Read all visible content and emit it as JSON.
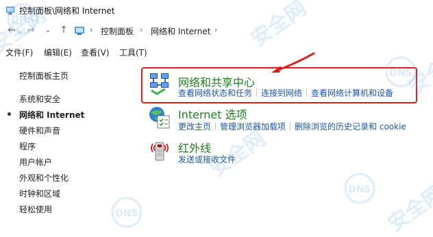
{
  "window": {
    "title": "控制面板\\网络和 Internet"
  },
  "nav": {
    "back_label": "←",
    "forward_label": "→",
    "dropdown_label": "⌄",
    "up_label": "↑",
    "breadcrumb": [
      {
        "label": "控制面板"
      },
      {
        "label": "网络和 Internet"
      }
    ],
    "separator": "›"
  },
  "menu": {
    "items": [
      {
        "label": "文件(F)"
      },
      {
        "label": "编辑(E)"
      },
      {
        "label": "查看(V)"
      },
      {
        "label": "工具(T)"
      }
    ]
  },
  "sidebar": {
    "items": [
      {
        "label": "控制面板主页",
        "current": false
      },
      {
        "label": "系统和安全",
        "current": false
      },
      {
        "label": "网络和 Internet",
        "current": true
      },
      {
        "label": "硬件和声音",
        "current": false
      },
      {
        "label": "程序",
        "current": false
      },
      {
        "label": "用户帐户",
        "current": false
      },
      {
        "label": "外观和个性化",
        "current": false
      },
      {
        "label": "时钟和区域",
        "current": false
      },
      {
        "label": "轻松使用",
        "current": false
      }
    ]
  },
  "categories": [
    {
      "title": "网络和共享中心",
      "icon": "network-sharing-icon",
      "links": [
        "查看网络状态和任务",
        "连接到网络",
        "查看网络计算机和设备"
      ]
    },
    {
      "title": "Internet 选项",
      "icon": "internet-options-icon",
      "links": [
        "更改主页",
        "管理浏览器加载项",
        "删除浏览的历史记录和 cookie"
      ]
    },
    {
      "title": "红外线",
      "icon": "infrared-icon",
      "links": [
        "发送或接收文件"
      ]
    }
  ],
  "watermark": {
    "text": "安全网",
    "logo": "DNS"
  },
  "colors": {
    "category_title": "#1e7e1e",
    "link": "#1a55b0",
    "highlight": "#e01b1b",
    "watermark": "#6eaae6"
  }
}
